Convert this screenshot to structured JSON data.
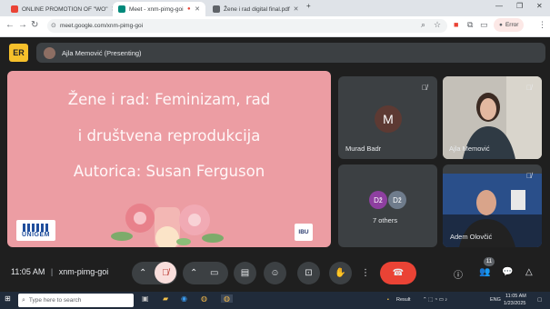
{
  "browser": {
    "tabs": [
      {
        "title": "ONLINE PROMOTION OF \"WO\"",
        "favicon_color": "#ea4335"
      },
      {
        "title": "Meet - xnm-pimg-goi",
        "favicon_color": "#00897b"
      },
      {
        "title": "Žene i rad digital final.pdf",
        "favicon_color": "#5f6368"
      }
    ],
    "url": "meet.google.com/xnm-pimg-goi",
    "profile_label": "Error"
  },
  "meet": {
    "logo_text": "ER",
    "presenter_label": "Ajla Memović (Presenting)",
    "slide": {
      "line1": "Žene i rad: Feminizam, rad",
      "line2": "i društvena reprodukcija",
      "line3": "Autorica: Susan Ferguson",
      "left_logo_text": "UNIGEM",
      "right_logo_text": "IBU",
      "background_color": "#ec9da3"
    },
    "tiles": {
      "murad": {
        "initial": "M",
        "name": "Murad Badr"
      },
      "ajla": {
        "name": "Ajla Memović"
      },
      "others": {
        "avatars": [
          "Dž",
          "Dž"
        ],
        "label": "7 others"
      },
      "adem": {
        "name": "Adem Olovčić"
      }
    },
    "bottom": {
      "time": "11:05 AM",
      "separator": "|",
      "meeting_code": "xnm-pimg-goi",
      "participants_count": "11"
    }
  },
  "taskbar": {
    "search_placeholder": "Type here to search",
    "result_label": "Result",
    "lang": "ENG",
    "clock_time": "11:05 AM",
    "clock_date": "1/23/2025"
  }
}
